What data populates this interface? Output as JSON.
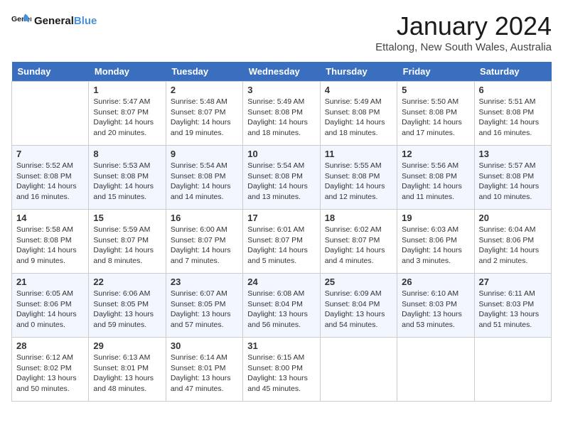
{
  "header": {
    "logo_general": "General",
    "logo_blue": "Blue",
    "month": "January 2024",
    "location": "Ettalong, New South Wales, Australia"
  },
  "days_of_week": [
    "Sunday",
    "Monday",
    "Tuesday",
    "Wednesday",
    "Thursday",
    "Friday",
    "Saturday"
  ],
  "weeks": [
    [
      {
        "day": "",
        "info": ""
      },
      {
        "day": "1",
        "info": "Sunrise: 5:47 AM\nSunset: 8:07 PM\nDaylight: 14 hours\nand 20 minutes."
      },
      {
        "day": "2",
        "info": "Sunrise: 5:48 AM\nSunset: 8:07 PM\nDaylight: 14 hours\nand 19 minutes."
      },
      {
        "day": "3",
        "info": "Sunrise: 5:49 AM\nSunset: 8:08 PM\nDaylight: 14 hours\nand 18 minutes."
      },
      {
        "day": "4",
        "info": "Sunrise: 5:49 AM\nSunset: 8:08 PM\nDaylight: 14 hours\nand 18 minutes."
      },
      {
        "day": "5",
        "info": "Sunrise: 5:50 AM\nSunset: 8:08 PM\nDaylight: 14 hours\nand 17 minutes."
      },
      {
        "day": "6",
        "info": "Sunrise: 5:51 AM\nSunset: 8:08 PM\nDaylight: 14 hours\nand 16 minutes."
      }
    ],
    [
      {
        "day": "7",
        "info": "Sunrise: 5:52 AM\nSunset: 8:08 PM\nDaylight: 14 hours\nand 16 minutes."
      },
      {
        "day": "8",
        "info": "Sunrise: 5:53 AM\nSunset: 8:08 PM\nDaylight: 14 hours\nand 15 minutes."
      },
      {
        "day": "9",
        "info": "Sunrise: 5:54 AM\nSunset: 8:08 PM\nDaylight: 14 hours\nand 14 minutes."
      },
      {
        "day": "10",
        "info": "Sunrise: 5:54 AM\nSunset: 8:08 PM\nDaylight: 14 hours\nand 13 minutes."
      },
      {
        "day": "11",
        "info": "Sunrise: 5:55 AM\nSunset: 8:08 PM\nDaylight: 14 hours\nand 12 minutes."
      },
      {
        "day": "12",
        "info": "Sunrise: 5:56 AM\nSunset: 8:08 PM\nDaylight: 14 hours\nand 11 minutes."
      },
      {
        "day": "13",
        "info": "Sunrise: 5:57 AM\nSunset: 8:08 PM\nDaylight: 14 hours\nand 10 minutes."
      }
    ],
    [
      {
        "day": "14",
        "info": "Sunrise: 5:58 AM\nSunset: 8:08 PM\nDaylight: 14 hours\nand 9 minutes."
      },
      {
        "day": "15",
        "info": "Sunrise: 5:59 AM\nSunset: 8:07 PM\nDaylight: 14 hours\nand 8 minutes."
      },
      {
        "day": "16",
        "info": "Sunrise: 6:00 AM\nSunset: 8:07 PM\nDaylight: 14 hours\nand 7 minutes."
      },
      {
        "day": "17",
        "info": "Sunrise: 6:01 AM\nSunset: 8:07 PM\nDaylight: 14 hours\nand 5 minutes."
      },
      {
        "day": "18",
        "info": "Sunrise: 6:02 AM\nSunset: 8:07 PM\nDaylight: 14 hours\nand 4 minutes."
      },
      {
        "day": "19",
        "info": "Sunrise: 6:03 AM\nSunset: 8:06 PM\nDaylight: 14 hours\nand 3 minutes."
      },
      {
        "day": "20",
        "info": "Sunrise: 6:04 AM\nSunset: 8:06 PM\nDaylight: 14 hours\nand 2 minutes."
      }
    ],
    [
      {
        "day": "21",
        "info": "Sunrise: 6:05 AM\nSunset: 8:06 PM\nDaylight: 14 hours\nand 0 minutes."
      },
      {
        "day": "22",
        "info": "Sunrise: 6:06 AM\nSunset: 8:05 PM\nDaylight: 13 hours\nand 59 minutes."
      },
      {
        "day": "23",
        "info": "Sunrise: 6:07 AM\nSunset: 8:05 PM\nDaylight: 13 hours\nand 57 minutes."
      },
      {
        "day": "24",
        "info": "Sunrise: 6:08 AM\nSunset: 8:04 PM\nDaylight: 13 hours\nand 56 minutes."
      },
      {
        "day": "25",
        "info": "Sunrise: 6:09 AM\nSunset: 8:04 PM\nDaylight: 13 hours\nand 54 minutes."
      },
      {
        "day": "26",
        "info": "Sunrise: 6:10 AM\nSunset: 8:03 PM\nDaylight: 13 hours\nand 53 minutes."
      },
      {
        "day": "27",
        "info": "Sunrise: 6:11 AM\nSunset: 8:03 PM\nDaylight: 13 hours\nand 51 minutes."
      }
    ],
    [
      {
        "day": "28",
        "info": "Sunrise: 6:12 AM\nSunset: 8:02 PM\nDaylight: 13 hours\nand 50 minutes."
      },
      {
        "day": "29",
        "info": "Sunrise: 6:13 AM\nSunset: 8:01 PM\nDaylight: 13 hours\nand 48 minutes."
      },
      {
        "day": "30",
        "info": "Sunrise: 6:14 AM\nSunset: 8:01 PM\nDaylight: 13 hours\nand 47 minutes."
      },
      {
        "day": "31",
        "info": "Sunrise: 6:15 AM\nSunset: 8:00 PM\nDaylight: 13 hours\nand 45 minutes."
      },
      {
        "day": "",
        "info": ""
      },
      {
        "day": "",
        "info": ""
      },
      {
        "day": "",
        "info": ""
      }
    ]
  ]
}
